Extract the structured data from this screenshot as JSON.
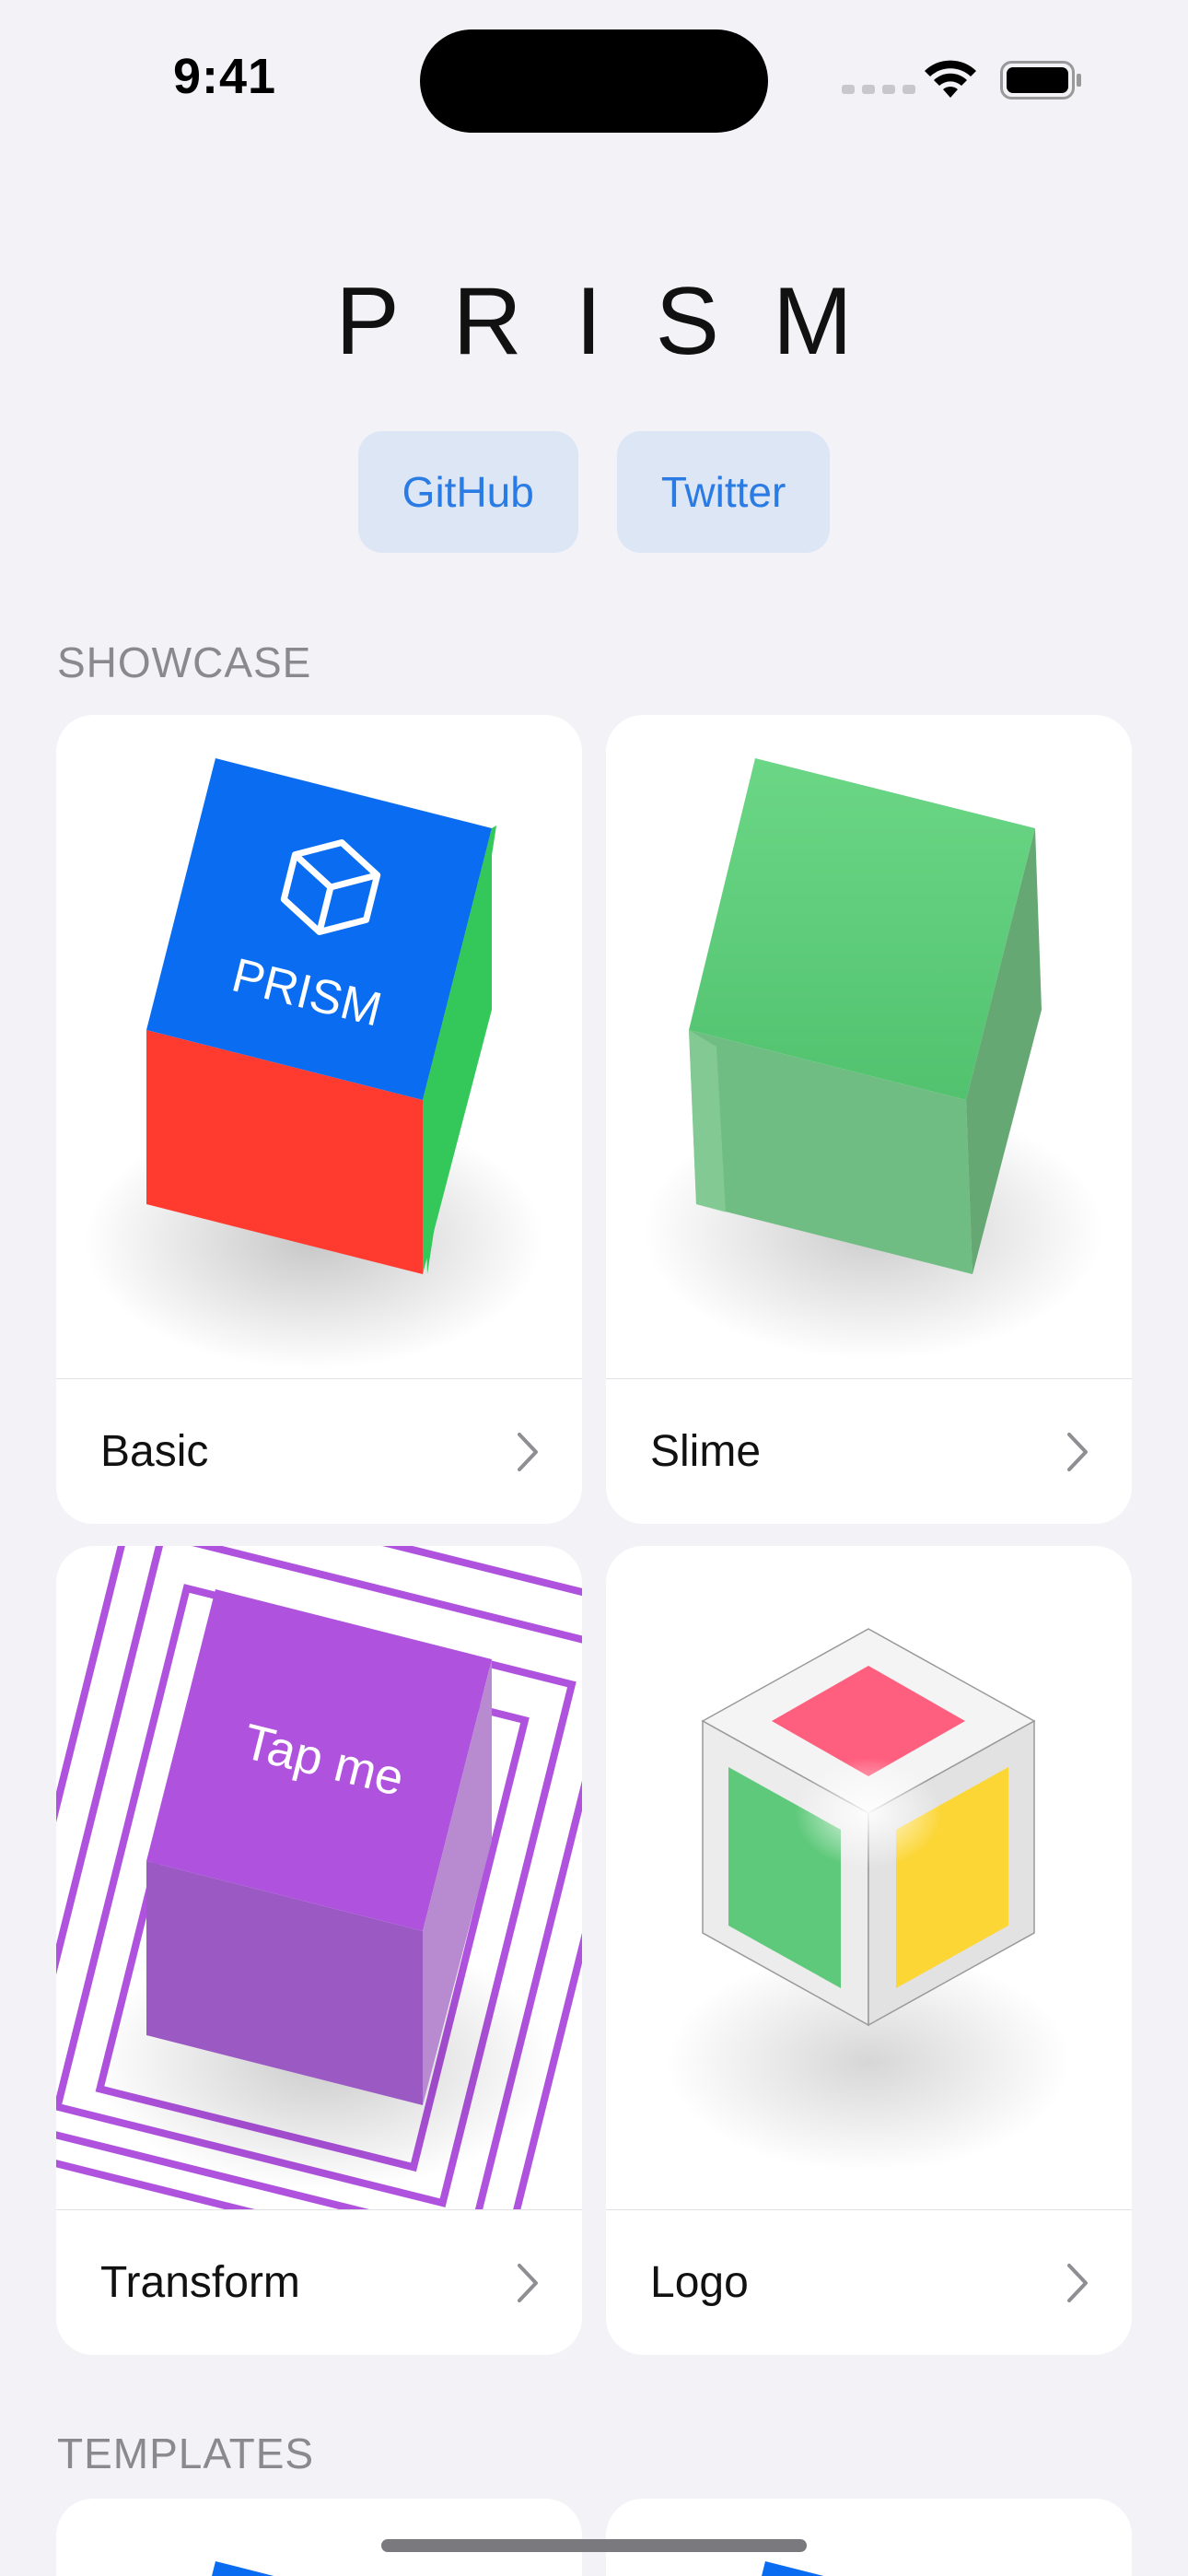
{
  "status_bar": {
    "time": "9:41"
  },
  "header": {
    "title": "PRISM"
  },
  "links": [
    {
      "label": "GitHub"
    },
    {
      "label": "Twitter"
    }
  ],
  "sections": {
    "showcase": "SHOWCASE",
    "templates": "TEMPLATES"
  },
  "showcase": [
    {
      "label": "Basic",
      "preview_text": "PRISM"
    },
    {
      "label": "Slime"
    },
    {
      "label": "Transform",
      "preview_text": "Tap me"
    },
    {
      "label": "Logo"
    }
  ],
  "colors": {
    "accent": "#2a7be3",
    "blue": "#0a6cf0",
    "red": "#ff3b30",
    "green": "#34c759",
    "purple": "#af52de",
    "pink": "#ff5f7e",
    "yellow": "#fcd635"
  }
}
